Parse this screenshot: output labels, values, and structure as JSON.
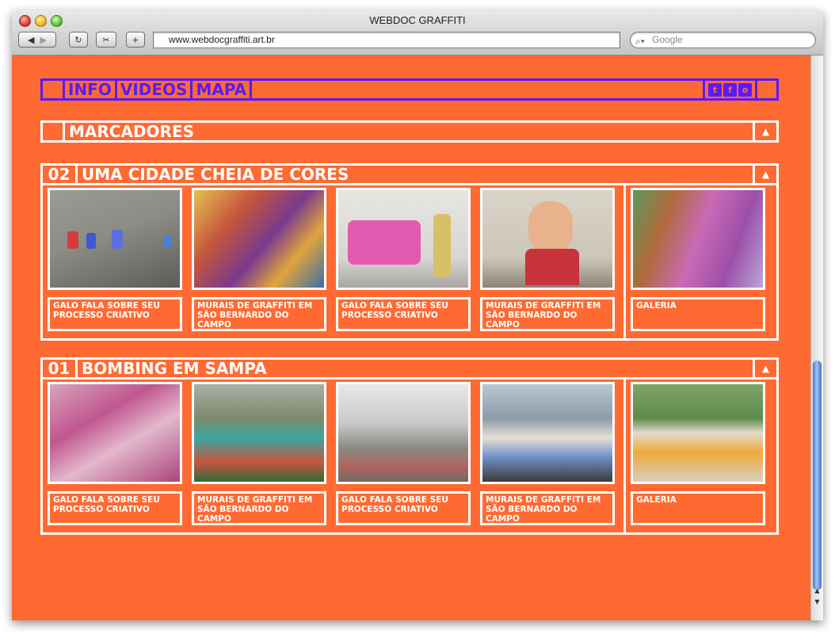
{
  "browser": {
    "window_title": "WEBDOC GRAFFITI",
    "url": "www.webdocgraffiti.art.br",
    "search_placeholder": "Google"
  },
  "nav": {
    "links": [
      "INFO",
      "VIDEOS",
      "MAPA"
    ],
    "social": [
      "t",
      "f",
      "o"
    ]
  },
  "marcadores": {
    "title": "MARCADORES"
  },
  "sections": [
    {
      "number": "02",
      "title": "UMA CIDADE CHEIA DE CORES",
      "items": [
        "GALO FALA SOBRE SEU PROCESSO CRIATIVO",
        "MURAIS DE GRAFFITI EM SÃO BERNARDO DO CAMPO",
        "GALO FALA SOBRE SEU PROCESSO CRIATIVO",
        "MURAIS DE GRAFFITI EM SÃO BERNARDO DO CAMPO",
        "GALERIA"
      ]
    },
    {
      "number": "01",
      "title": "BOMBING EM SAMPA",
      "items": [
        "GALO FALA SOBRE SEU PROCESSO CRIATIVO",
        "MURAIS DE GRAFFITI EM SÃO BERNARDO DO CAMPO",
        "GALO FALA SOBRE SEU PROCESSO CRIATIVO",
        "MURAIS DE GRAFFITI EM SÃO BERNARDO DO CAMPO",
        "GALERIA"
      ]
    }
  ],
  "colors": {
    "background": "#ff6a33",
    "nav_accent": "#5a1aff",
    "frame": "#ffffff"
  }
}
